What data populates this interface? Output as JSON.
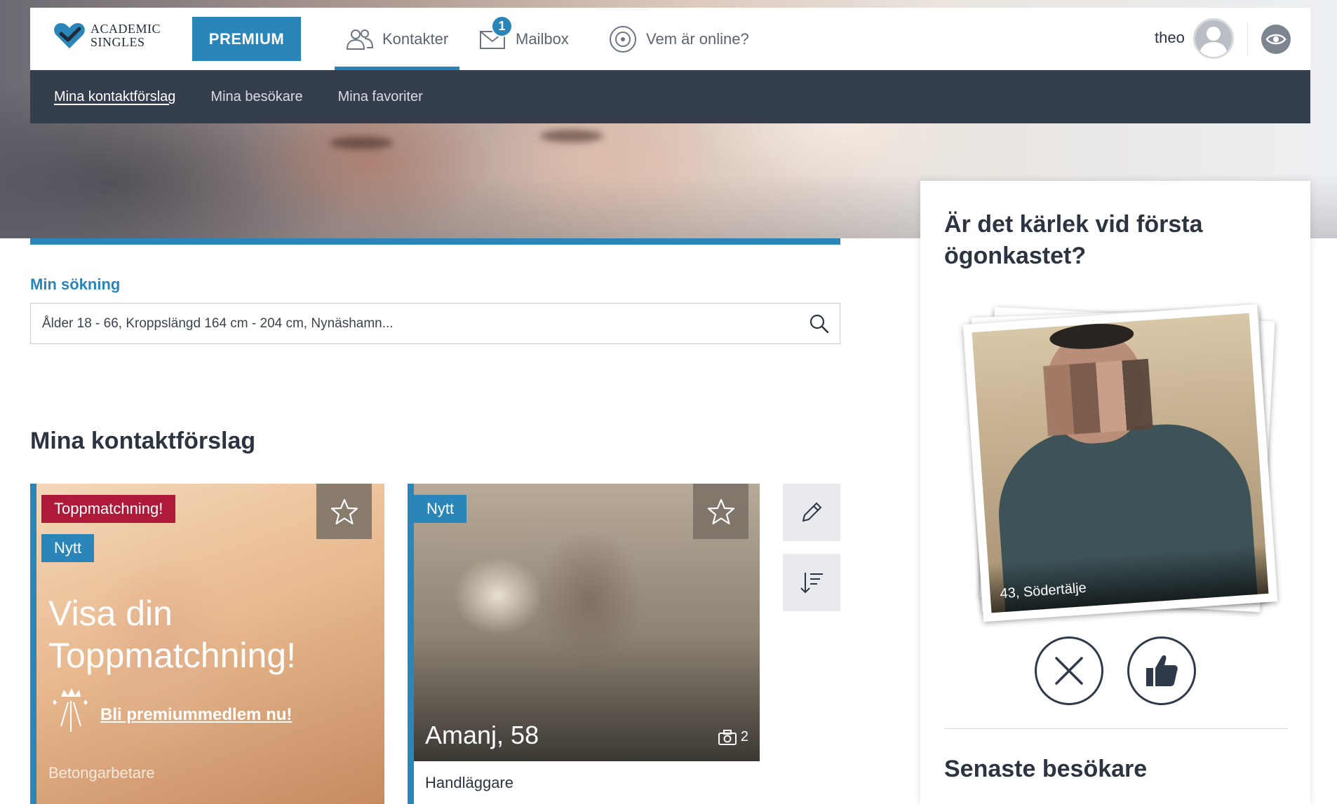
{
  "brand": {
    "line1": "ACADEMIC",
    "line2": "SINGLES"
  },
  "header": {
    "premium_label": "PREMIUM",
    "nav": [
      {
        "label": "Kontakter",
        "icon": "contacts-icon",
        "active": true
      },
      {
        "label": "Mailbox",
        "icon": "mail-icon",
        "badge": "1"
      },
      {
        "label": "Vem är online?",
        "icon": "online-icon"
      }
    ],
    "user_name": "theo"
  },
  "subnav": [
    {
      "label": "Mina kontaktförslag",
      "active": true
    },
    {
      "label": "Mina besökare"
    },
    {
      "label": "Mina favoriter"
    }
  ],
  "search": {
    "label": "Min sökning",
    "value": "Ålder 18 - 66, Kroppslängd 164 cm - 204 cm, Nynäshamn..."
  },
  "section_title": "Mina kontaktförslag",
  "cards": [
    {
      "tag_top": "Toppmatchning!",
      "tag_new": "Nytt",
      "promo_line1": "Visa din",
      "promo_line2": "Toppmatchning!",
      "cta": "Bli premiummedlem nu!",
      "job": "Betongarbetare"
    },
    {
      "tag_new": "Nytt",
      "name": "Amanj, 58",
      "photo_count": "2",
      "job": "Handläggare"
    }
  ],
  "panel": {
    "title": "Är det kärlek vid första ögonkastet?",
    "profile_caption": "43, Södertälje",
    "recent_title": "Senaste besökare"
  },
  "colors": {
    "accent": "#2a86b8",
    "dark_nav": "#353e4d",
    "top_match": "#b01a3a"
  }
}
